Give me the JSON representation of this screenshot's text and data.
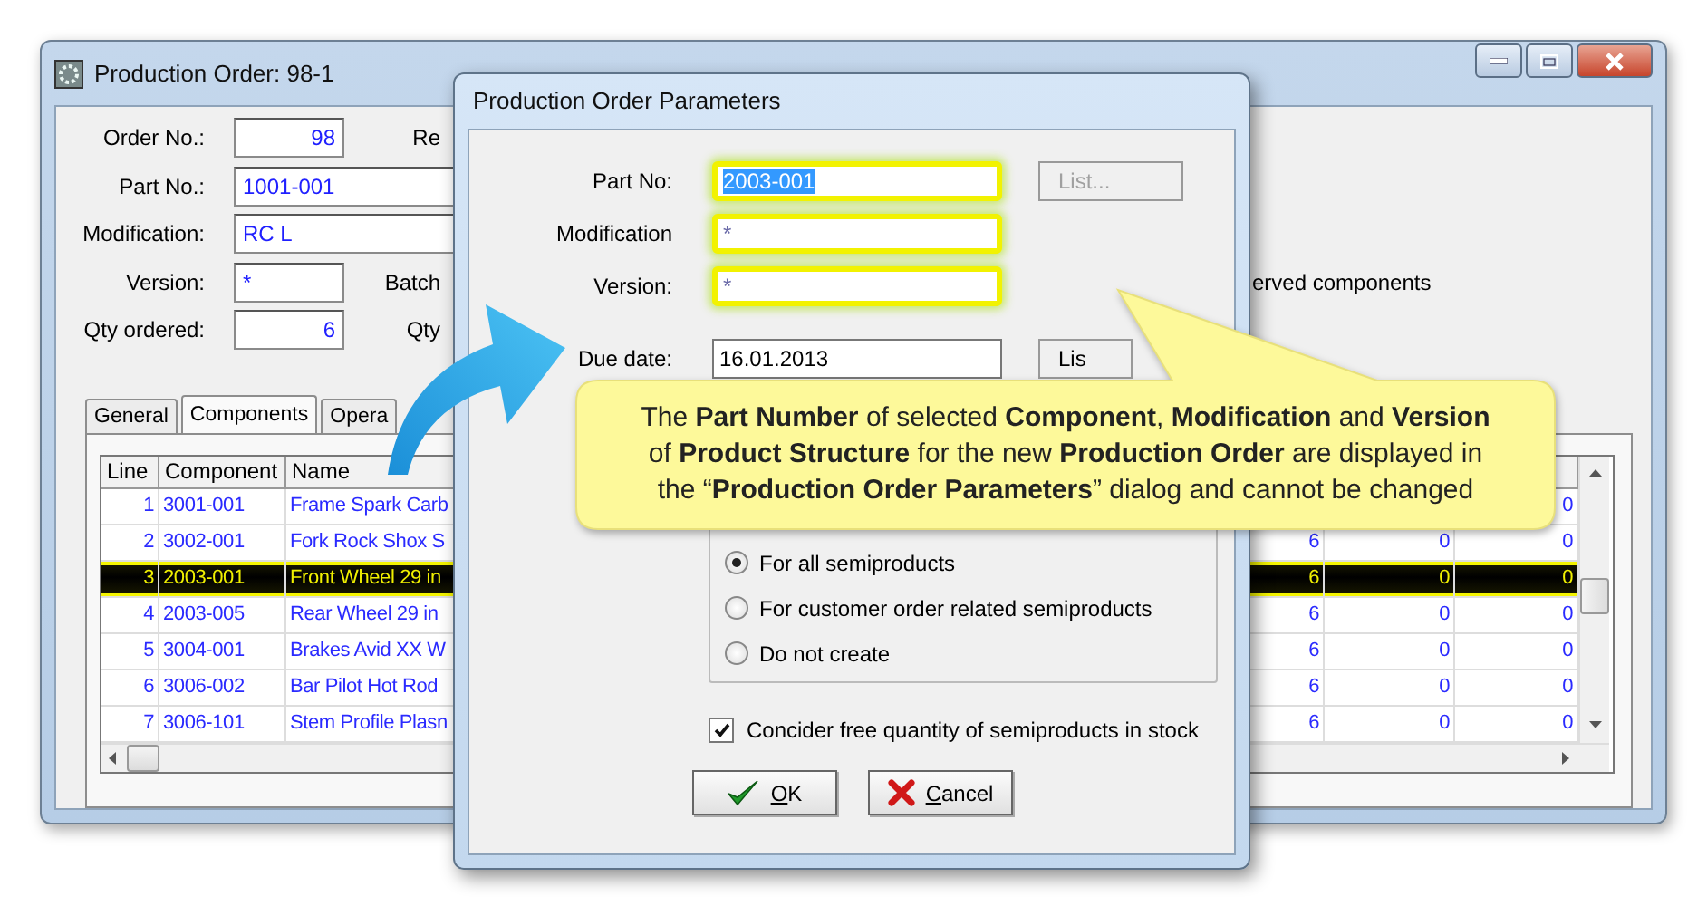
{
  "main_window": {
    "title": "Production Order: 98-1",
    "fields": [
      {
        "label": "Order No.:",
        "value": "98",
        "kind": "numeric",
        "side_label": "Re"
      },
      {
        "label": "Part No.:",
        "value": "1001-001",
        "kind": "text"
      },
      {
        "label": "Modification:",
        "value": "RC L",
        "kind": "text"
      },
      {
        "label": "Version:",
        "value": "*",
        "kind": "symbol",
        "side_label": "Batch"
      },
      {
        "label": "Qty ordered:",
        "value": "6",
        "kind": "numeric",
        "side_label": "Qty"
      }
    ],
    "option_text": "erved components",
    "tabs": [
      {
        "label": "General",
        "selected": false
      },
      {
        "label": "Components",
        "selected": true
      },
      {
        "label": "Opera",
        "selected": false
      }
    ],
    "table": {
      "columns": [
        "Line",
        "Component",
        "Name"
      ],
      "rows": [
        {
          "line": "1",
          "component": "3001-001",
          "name": "Frame Spark Carb",
          "column_6": "0",
          "selected": false
        },
        {
          "line": "2",
          "component": "3002-001",
          "name": "Fork Rock Shox S",
          "column_4": "6",
          "column_5": "0",
          "column_6": "0",
          "selected": false
        },
        {
          "line": "3",
          "component": "2003-001",
          "name": "Front Wheel 29 in",
          "column_4": "6",
          "column_5": "0",
          "column_6": "0",
          "selected": true
        },
        {
          "line": "4",
          "component": "2003-005",
          "name": "Rear Wheel 29 in",
          "column_4": "6",
          "column_5": "0",
          "column_6": "0",
          "selected": false
        },
        {
          "line": "5",
          "component": "3004-001",
          "name": "Brakes Avid XX W",
          "column_4": "6",
          "column_5": "0",
          "column_6": "0",
          "selected": false
        },
        {
          "line": "6",
          "component": "3006-002",
          "name": "Bar Pilot Hot Rod",
          "column_4": "6",
          "column_5": "0",
          "column_6": "0",
          "selected": false
        },
        {
          "line": "7",
          "component": "3006-101",
          "name": "Stem Profile Plasn",
          "column_4": "6",
          "column_5": "0",
          "column_6": "0",
          "selected": false
        }
      ]
    }
  },
  "dialog": {
    "title": "Production Order Parameters",
    "fields": [
      {
        "label": "Part No:",
        "value": "2003-001",
        "highlighted": true,
        "text_selected": true,
        "button": {
          "label": "List...",
          "disabled": true
        }
      },
      {
        "label": "Modification",
        "value": "*",
        "highlighted": true,
        "text_selected": false
      },
      {
        "label": "Version:",
        "value": "*",
        "highlighted": true,
        "text_selected": false
      },
      {
        "label": "Due date:",
        "value": "16.01.2013",
        "highlighted": false,
        "text_selected": false,
        "button": {
          "label": "Lis",
          "disabled": false
        }
      }
    ],
    "radios": [
      {
        "label": "For all semiproducts",
        "selected": true
      },
      {
        "label": "For customer order related semiproducts",
        "selected": false
      },
      {
        "label": "Do not create",
        "selected": false
      }
    ],
    "checkbox": {
      "label": "Concider free quantity of semiproducts in stock",
      "checked": true
    },
    "buttons": [
      {
        "label": "OK",
        "kind": "ok"
      },
      {
        "label": "Cancel",
        "kind": "cancel"
      }
    ]
  },
  "callout": {
    "lines": [
      "The **Part Number** of selected **Component**, **Modification** and **Version**",
      "of **Product Structure** for the new **Production Order** are displayed in",
      "the “**Production Order Parameters**” dialog and cannot be changed"
    ]
  }
}
